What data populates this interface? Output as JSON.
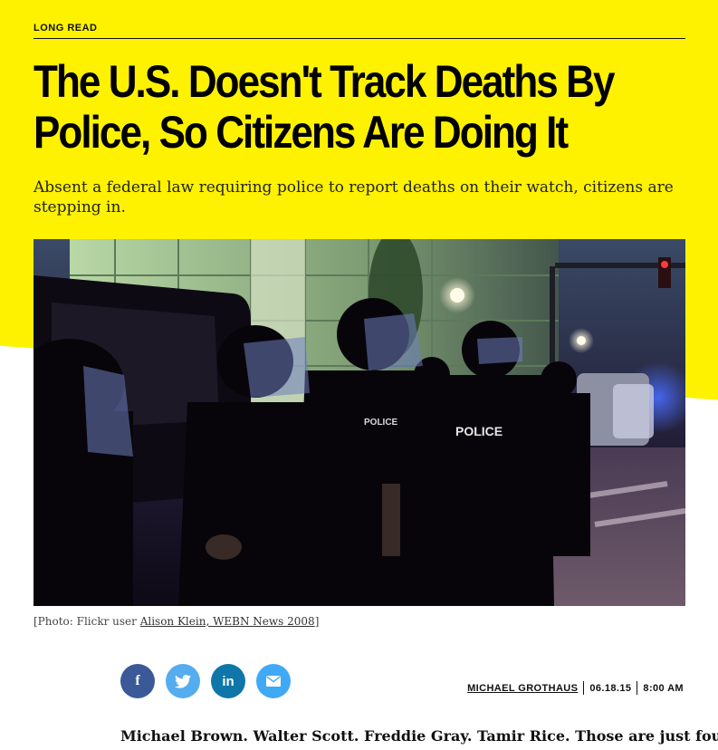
{
  "article": {
    "kicker": "LONG READ",
    "headline": "The U.S. Doesn't Track Deaths By Police, So Citizens Are Doing It",
    "dek": "Absent a federal law requiring police to report deaths on their watch, citizens are stepping in.",
    "caption_prefix": "[Photo: Flickr user ",
    "caption_link": "Alison Klein, WEBN News 2008",
    "caption_suffix": "]",
    "photo_text": {
      "vest_left": "POLICE",
      "vest_right": "POLICE"
    },
    "share": {
      "facebook": "f",
      "linkedin": "in"
    },
    "byline": {
      "author": "MICHAEL GROTHAUS",
      "date": "06.18.15",
      "time": "8:00 AM"
    },
    "lede": "Michael Brown. Walter Scott. Freddie Gray. Tamir Rice. Those are just four"
  },
  "colors": {
    "accent_yellow": "#fff200",
    "facebook": "#3b5998",
    "twitter": "#55acee",
    "linkedin": "#0e76a8",
    "email": "#3fa9f5"
  }
}
